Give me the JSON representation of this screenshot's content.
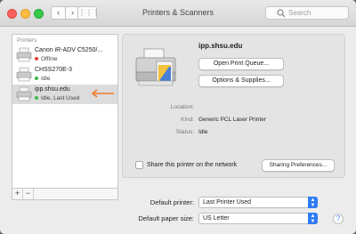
{
  "window": {
    "title": "Printers & Scanners"
  },
  "toolbar": {
    "back_glyph": "‹",
    "forward_glyph": "›",
    "grid_glyph": "⋮⋮⋮",
    "search_placeholder": "Search"
  },
  "sidebar": {
    "header": "Printers",
    "printers": [
      {
        "name": "Canon iR-ADV C5250/...",
        "status": "Offline",
        "status_color": "#e0423c",
        "icon": "printer-icon"
      },
      {
        "name": "CHSS270E-3",
        "status": "Idle",
        "status_color": "#3cb84b",
        "icon": "printer-icon"
      },
      {
        "name": "ipp.shsu.edu",
        "status": "Idle, Last Used",
        "status_color": "#3cb84b",
        "icon": "printer-icon",
        "selected": true
      }
    ],
    "add_label": "+",
    "remove_label": "−",
    "annotation_arrow_color": "#f07a28"
  },
  "detail": {
    "name": "ipp.shsu.edu",
    "open_queue_label": "Open Print Queue...",
    "options_label": "Options & Supplies...",
    "location_label": "Location:",
    "location_value": "",
    "kind_label": "Kind:",
    "kind_value": "Generic PCL Laser Printer",
    "status_label": "Status:",
    "status_value": "Idle",
    "share_label": "Share this printer on the network",
    "share_checked": false,
    "sharing_prefs_label": "Sharing Preferences..."
  },
  "defaults": {
    "printer_label": "Default printer:",
    "printer_value": "Last Printer Used",
    "paper_label": "Default paper size:",
    "paper_value": "US Letter"
  },
  "help_label": "?",
  "colors": {
    "accent": "#2f7cf6"
  }
}
